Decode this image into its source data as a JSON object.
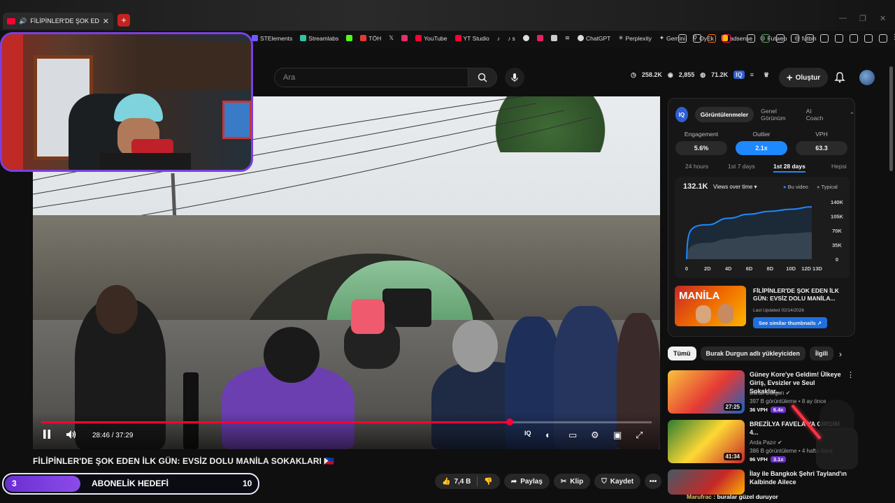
{
  "browser": {
    "tab_title": "FİLİPİNLER'DE ŞOK EDEN İLK",
    "bookmarks": [
      "STElements",
      "Streamlabs",
      "TÖH",
      "YouTube",
      "YT Studio",
      "ChatGPT",
      "Perplexity",
      "Gemini",
      "OyEk",
      "adsense",
      "Futweb",
      "futbin"
    ]
  },
  "header": {
    "search_placeholder": "Ara",
    "stat_views": "258.2K",
    "stat_subs": "2,855",
    "stat_watch": "71.2K",
    "create_label": "Oluştur"
  },
  "video": {
    "current_time": "28:46",
    "duration": "37:29",
    "time_display": "28:46 / 37:29",
    "progress_fraction": 0.768,
    "title": "FİLİPİNLER'DE ŞOK EDEN İLK GÜN: EVSİZ DOLU MANİLA SOKAKLARI 🇵🇭",
    "likes": "7,4 B",
    "share_label": "Paylaş",
    "clip_label": "Klip",
    "save_label": "Kaydet"
  },
  "sub_goal": {
    "current": "3",
    "label": "ABONELİK HEDEFİ",
    "target": "10"
  },
  "panel": {
    "logo": "IQ",
    "tabs": [
      "Görüntülenmeler",
      "Genel Görünüm",
      "AI Coach"
    ],
    "metrics": [
      {
        "label": "Engagement",
        "value": "5.6%"
      },
      {
        "label": "Outlier",
        "value": "2.1x"
      },
      {
        "label": "VPH",
        "value": "63.3"
      }
    ],
    "ranges": [
      "24 hours",
      "1st 7 days",
      "1st 28 days",
      "Hepsi"
    ],
    "chart_total": "132.1K",
    "chart_selector": "Views over time",
    "legend_this": "Bu video",
    "legend_typical": "Typical",
    "thumb_title": "FİLİPİNLER'DE ŞOK EDEN İLK GÜN: EVSİZ DOLU MANİLA...",
    "thumb_date": "Last Updated 02/14/2026",
    "thumb_button": "See similar thumbnails"
  },
  "chart_data": {
    "type": "area",
    "x": [
      "0",
      "2D",
      "4D",
      "6D",
      "8D",
      "10D",
      "12D 13D"
    ],
    "y_ticks": [
      "140K",
      "105K",
      "70K",
      "35K",
      "0"
    ],
    "ylim": [
      0,
      140000
    ],
    "series": [
      {
        "name": "Bu video",
        "values": [
          0,
          84000,
          100000,
          110000,
          117000,
          122000,
          128000
        ]
      },
      {
        "name": "Typical",
        "values": [
          0,
          40000,
          50000,
          56000,
          60000,
          63000,
          66000
        ]
      }
    ]
  },
  "chips": [
    "Tümü",
    "Burak Durgun adlı yükleyiciden",
    "İlgili"
  ],
  "recommendations": [
    {
      "title": "Güney Kore'ye Geldim! Ülkeye Giriş, Evsizler ve Seul Sokaklar...",
      "channel": "Burak Durgun",
      "views": "397 B görüntüleme • 8 ay önce",
      "vph": "36 VPH",
      "x": "6.4x",
      "duration": "27:25"
    },
    {
      "title": "BREZİLYA FAVELA'YA GİRDİM 4...",
      "channel": "Arda Pazır",
      "views": "386 B görüntüleme • 4 hafta önce",
      "vph": "96 VPH",
      "x": "3.1x",
      "duration": "41:34"
    },
    {
      "title": "İlay ile Bangkok Şehri Tayland'ın Kalbinde Ailece",
      "channel": "",
      "views": "",
      "vph": "",
      "x": "",
      "duration": ""
    }
  ],
  "chat": {
    "user": "Marufrac",
    "message": ": buralar güzel duruyor"
  }
}
